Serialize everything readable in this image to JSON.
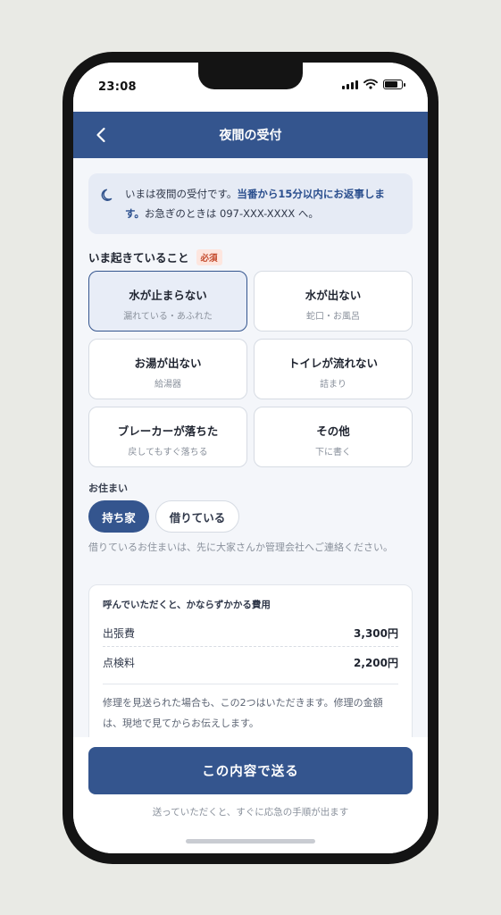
{
  "status_bar": {
    "time": "23:08"
  },
  "header": {
    "title": "夜間の受付"
  },
  "notice": {
    "text_pre": "いまは夜間の受付です。",
    "text_bold": "当番から15分以内にお返事します。",
    "text_post": "お急ぎのときは 097-XXX-XXXX へ。"
  },
  "issue_section": {
    "label": "いま起きていること",
    "required_badge": "必須",
    "options": [
      {
        "title": "水が止まらない",
        "sub": "漏れている・あふれた",
        "selected": true
      },
      {
        "title": "水が出ない",
        "sub": "蛇口・お風呂",
        "selected": false
      },
      {
        "title": "お湯が出ない",
        "sub": "給湯器",
        "selected": false
      },
      {
        "title": "トイレが流れない",
        "sub": "詰まり",
        "selected": false
      },
      {
        "title": "ブレーカーが落ちた",
        "sub": "戻してもすぐ落ちる",
        "selected": false
      },
      {
        "title": "その他",
        "sub": "下に書く",
        "selected": false
      }
    ]
  },
  "residence": {
    "label": "お住まい",
    "options": [
      {
        "label": "持ち家",
        "selected": true
      },
      {
        "label": "借りている",
        "selected": false
      }
    ],
    "note": "借りているお住まいは、先に大家さんか管理会社へご連絡ください。"
  },
  "fees": {
    "title": "呼んでいただくと、かならずかかる費用",
    "rows": [
      {
        "label": "出張費",
        "value": "3,300円"
      },
      {
        "label": "点検料",
        "value": "2,200円"
      }
    ],
    "description": "修理を見送られた場合も、この2つはいただきます。修理の金額は、現地で見てからお伝えします。"
  },
  "footer": {
    "submit_label": "この内容で送る",
    "hint": "送っていただくと、すぐに応急の手順が出ます"
  },
  "colors": {
    "primary": "#34558e",
    "background": "#f4f6fa",
    "required_badge": "#c44a2c"
  }
}
